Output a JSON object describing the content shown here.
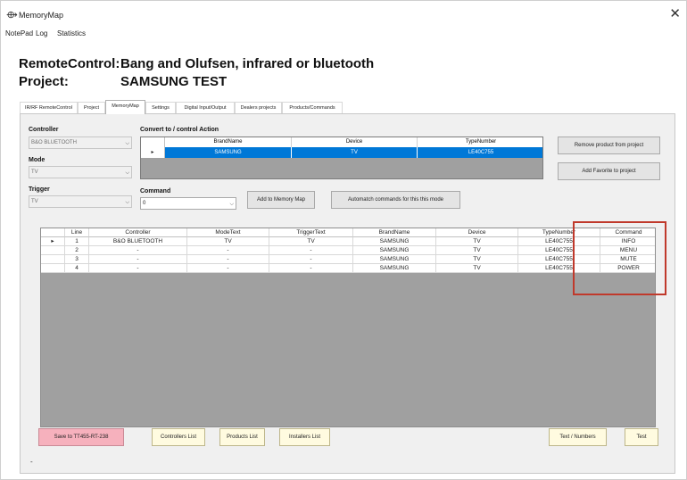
{
  "window": {
    "title": "MemoryMap",
    "close": "✕"
  },
  "menu": [
    "NotePad",
    "Log",
    "Statistics"
  ],
  "header": {
    "remote_label": "RemoteControl:",
    "remote_value": "Bang and Olufsen, infrared or bluetooth",
    "project_label": "Project:",
    "project_value": "SAMSUNG TEST"
  },
  "tabs": [
    "IR/RF RemoteControl",
    "Project",
    "MemoryMap",
    "Settings",
    "Digital Input/Output",
    "Dealers projects",
    "Products/Commands"
  ],
  "active_tab": "MemoryMap",
  "controller": {
    "label": "Controller",
    "value": "B&O BLUETOOTH"
  },
  "mode": {
    "label": "Mode",
    "value": "TV"
  },
  "trigger": {
    "label": "Trigger",
    "value": "TV"
  },
  "convert": {
    "label": "Convert to / control Action",
    "columns": [
      "BrandName",
      "Device",
      "TypeNumber"
    ],
    "row": {
      "indicator": "▸",
      "cells": [
        "SAMSUNG",
        "TV",
        "LE40C755"
      ]
    }
  },
  "command": {
    "label": "Command",
    "value": "0"
  },
  "buttons": {
    "add_to_memory_map": "Add to Memory Map",
    "automatch": "Automatch commands for this this mode",
    "remove_product": "Remove product from project",
    "add_favorite": "Add Favorite to project",
    "save": "Save to TT455-RT-238",
    "controllers_list": "Controllers List",
    "products_list": "Products List",
    "installers_list": "Installers List",
    "text_numbers": "Text / Numbers",
    "test": "Test"
  },
  "grid": {
    "columns": [
      "Line",
      "Controller",
      "ModeText",
      "TriggerText",
      "BrandName",
      "Device",
      "TypeNumber",
      "Command"
    ],
    "rows": [
      {
        "indicator": "▸",
        "cells": [
          "1",
          "B&O BLUETOOTH",
          "TV",
          "TV",
          "SAMSUNG",
          "TV",
          "LE40C755",
          "INFO"
        ]
      },
      {
        "indicator": "",
        "cells": [
          "2",
          "-",
          "-",
          "-",
          "SAMSUNG",
          "TV",
          "LE40C755",
          "MENU"
        ]
      },
      {
        "indicator": "",
        "cells": [
          "3",
          "-",
          "-",
          "-",
          "SAMSUNG",
          "TV",
          "LE40C755",
          "MUTE"
        ]
      },
      {
        "indicator": "",
        "cells": [
          "4",
          "-",
          "-",
          "-",
          "SAMSUNG",
          "TV",
          "LE40C755",
          "POWER"
        ]
      }
    ]
  },
  "footer_text": "-",
  "icons": {
    "app": "remote-control-icon",
    "dropdown": "chevron-down-icon",
    "row_selector": "row-pointer-icon"
  },
  "colors": {
    "selection": "#0078d7",
    "highlight_box": "#c0392b",
    "save_button": "#f6b1bd",
    "cream_button": "#fffbe0",
    "grid_background": "#a0a0a0"
  }
}
